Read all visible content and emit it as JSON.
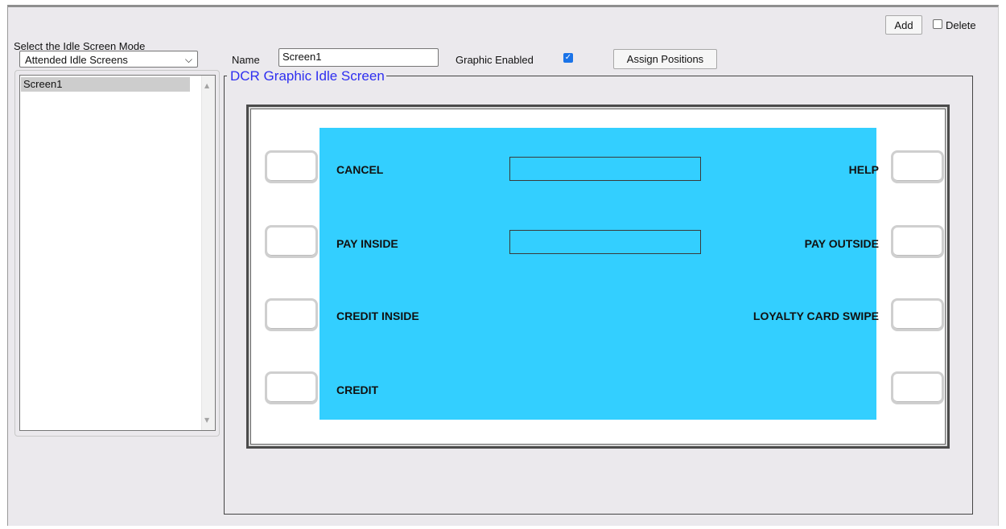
{
  "toolbar": {
    "add_label": "Add",
    "delete_label": "Delete",
    "delete_checked": false
  },
  "mode": {
    "label": "Select the Idle Screen Mode",
    "selected": "Attended Idle Screens",
    "screens": [
      "Screen1"
    ]
  },
  "form": {
    "name_label": "Name",
    "name_value": "Screen1",
    "graphic_label": "Graphic Enabled",
    "graphic_checked": true,
    "assign_label": "Assign Positions"
  },
  "dcr": {
    "legend": "DCR Graphic Idle Screen",
    "screen_color": "#33cfff",
    "left_labels": [
      "CANCEL",
      "PAY INSIDE",
      "CREDIT INSIDE",
      "CREDIT"
    ],
    "right_labels": [
      "HELP",
      "PAY OUTSIDE",
      "LOYALTY CARD SWIPE",
      ""
    ]
  }
}
